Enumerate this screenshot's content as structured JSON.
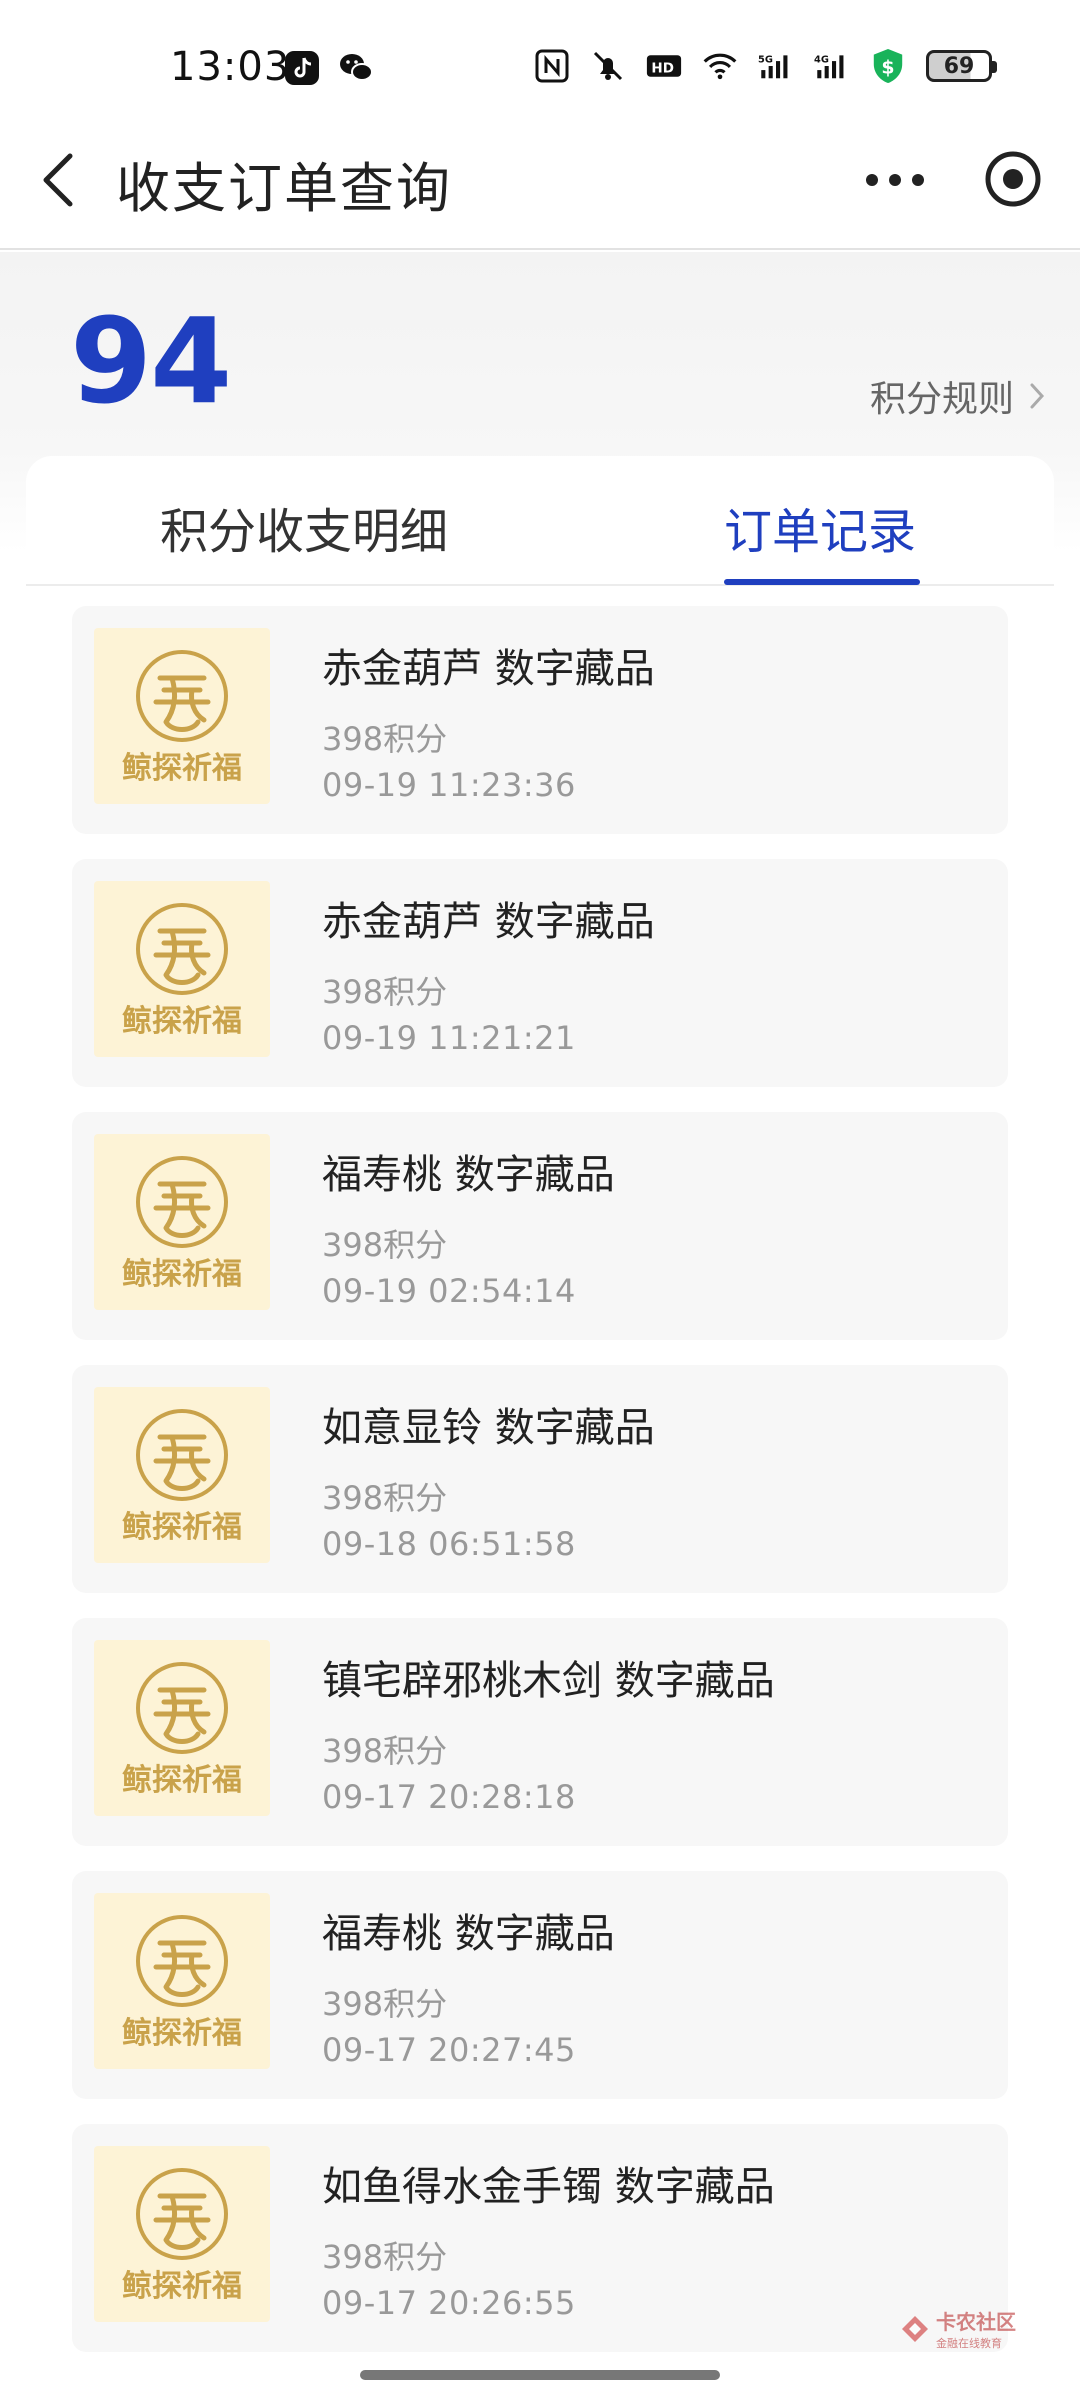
{
  "status_bar": {
    "time": "13:03",
    "battery": "69",
    "icons": [
      "tiktok-icon",
      "wechat-icon",
      "nfc-icon",
      "mute-icon",
      "hd-icon",
      "wifi-icon",
      "5g-signal-icon",
      "4g-signal-icon",
      "shield-dollar-icon",
      "battery-icon"
    ]
  },
  "nav": {
    "title": "收支订单查询",
    "back_icon": "chevron-left-icon",
    "more_icon": "more-dots-icon",
    "record_icon": "record-circle-icon"
  },
  "points": {
    "value": "94",
    "rules_label": "积分规则"
  },
  "tabs": [
    {
      "label": "积分收支明细",
      "active": false
    },
    {
      "label": "订单记录",
      "active": true
    }
  ],
  "thumb_text": "鲸探祈福",
  "orders": [
    {
      "name": "赤金葫芦 数字藏品",
      "points": "398积分",
      "time": "09-19 11:23:36"
    },
    {
      "name": "赤金葫芦 数字藏品",
      "points": "398积分",
      "time": "09-19 11:21:21"
    },
    {
      "name": "福寿桃 数字藏品",
      "points": "398积分",
      "time": "09-19 02:54:14"
    },
    {
      "name": "如意显铃 数字藏品",
      "points": "398积分",
      "time": "09-18 06:51:58"
    },
    {
      "name": "镇宅辟邪桃木剑 数字藏品",
      "points": "398积分",
      "time": "09-17 20:28:18"
    },
    {
      "name": "福寿桃 数字藏品",
      "points": "398积分",
      "time": "09-17 20:27:45"
    },
    {
      "name": "如鱼得水金手镯 数字藏品",
      "points": "398积分",
      "time": "09-17 20:26:55"
    }
  ],
  "watermark": {
    "main": "卡农社区",
    "sub": "金融在线教育"
  },
  "colors": {
    "accent": "#1f3fbf",
    "thumb_bg": "#fdf3d6",
    "thumb_gold": "#c9a24a"
  }
}
